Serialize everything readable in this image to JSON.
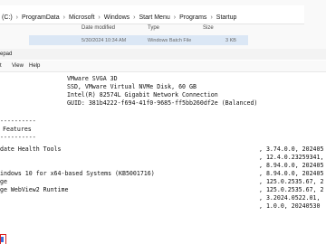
{
  "explorer": {
    "breadcrumb": [
      " (C:)",
      "ProgramData",
      "Microsoft",
      "Windows",
      "Start Menu",
      "Programs",
      "Startup"
    ],
    "columns": {
      "date": "Date modified",
      "type": "Type",
      "size": "Size"
    },
    "file": {
      "date": "5/30/2024 10:34 AM",
      "type": "Windows Batch File",
      "size": "3 KB"
    }
  },
  "notepad": {
    "title": "epad",
    "menu": [
      "t",
      "View",
      "Help"
    ],
    "hardware": [
      "VMware SVGA 3D",
      "SSD, VMware Virtual NVMe Disk, 60 GB",
      "Intel(R) 82574L Gigabit Network Connection",
      "GUID: 381b4222-f694-41f0-9685-ff5bb260df2e (Balanced)"
    ],
    "divider": "----------",
    "section_title": "Features",
    "features": [
      {
        "name": "date Health Tools",
        "version": ", 3.74.0.0, 202405"
      },
      {
        "name": "",
        "version": ", 12.4.0.23259341,"
      },
      {
        "name": "",
        "version": ", 8.94.0.0, 202405"
      },
      {
        "name": "indows 10 for x64-based Systems (KB5001716)",
        "version": ", 8.94.0.0, 202405"
      },
      {
        "name": "ge",
        "version": ", 125.0.2535.67, 2"
      },
      {
        "name": "ge WebView2 Runtime",
        "version": ", 125.0.2535.67, 2"
      },
      {
        "name": "",
        "version": ", 3.2024.0522.01,"
      },
      {
        "name": "",
        "version": ", 1.0.0, 20240530"
      }
    ]
  }
}
